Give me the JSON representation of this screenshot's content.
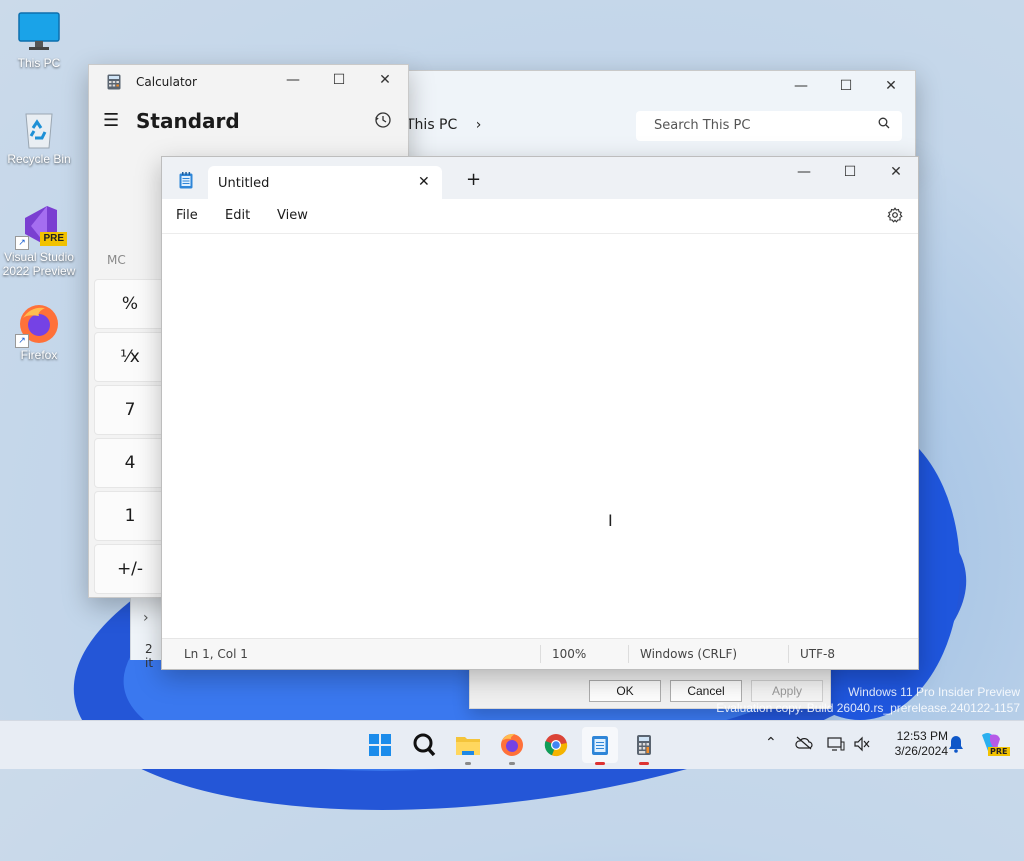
{
  "desktop": {
    "icons": [
      {
        "label": "This PC"
      },
      {
        "label": "Recycle Bin"
      },
      {
        "label": "Visual Studio 2022 Preview",
        "badge": "PRE"
      },
      {
        "label": "Firefox"
      }
    ]
  },
  "explorer": {
    "address": "This PC",
    "search_placeholder": "Search This PC",
    "status": "2 it"
  },
  "dialog": {
    "ok": "OK",
    "cancel": "Cancel",
    "apply": "Apply"
  },
  "calculator": {
    "title": "Calculator",
    "mode": "Standard",
    "memory": "MC",
    "keys": [
      "%",
      "¹⁄x",
      "7",
      "4",
      "1",
      "+/-"
    ]
  },
  "notepad": {
    "tab_title": "Untitled",
    "menu": [
      "File",
      "Edit",
      "View"
    ],
    "status": {
      "position": "Ln 1, Col 1",
      "zoom": "100%",
      "line_ending": "Windows (CRLF)",
      "encoding": "UTF-8"
    }
  },
  "watermark": {
    "line1": "Windows 11 Pro Insider Preview",
    "line2": "Evaluation copy. Build 26040.rs_prerelease.240122-1157"
  },
  "taskbar": {
    "time": "12:53 PM",
    "date": "3/26/2024",
    "copilot_badge": "PRE"
  },
  "colors": {
    "accent": "#0067c0",
    "wallpaper_blue": "#1b4fd6"
  }
}
